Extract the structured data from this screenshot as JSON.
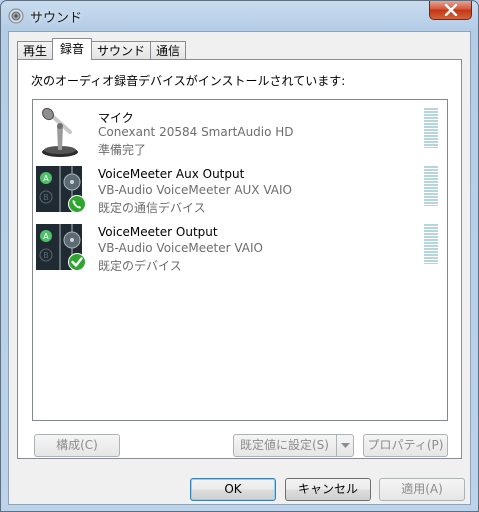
{
  "window": {
    "title": "サウンド"
  },
  "tabs": [
    {
      "label": "再生"
    },
    {
      "label": "録音"
    },
    {
      "label": "サウンド"
    },
    {
      "label": "通信"
    }
  ],
  "panel": {
    "instruction": "次のオーディオ録音デバイスがインストールされています:"
  },
  "devices": [
    {
      "name": "マイク",
      "driver": "Conexant 20584 SmartAudio HD",
      "status": "準備完了",
      "icon": "microphone-icon"
    },
    {
      "name": "VoiceMeeter Aux Output",
      "driver": "VB-Audio VoiceMeeter AUX VAIO",
      "status": "既定の通信デバイス",
      "icon": "voicemeeter-icon",
      "badge": "phone-badge-icon"
    },
    {
      "name": "VoiceMeeter Output",
      "driver": "VB-Audio VoiceMeeter VAIO",
      "status": "既定のデバイス",
      "icon": "voicemeeter-icon",
      "badge": "checkmark-badge-icon"
    }
  ],
  "panel_buttons": {
    "configure": "構成(C)",
    "set_default": "既定値に設定(S)",
    "properties": "プロパティ(P)"
  },
  "dialog_buttons": {
    "ok": "OK",
    "cancel": "キャンセル",
    "apply": "適用(A)"
  },
  "colors": {
    "close_button": "#c74a2a",
    "badge_green": "#2fa52f"
  }
}
